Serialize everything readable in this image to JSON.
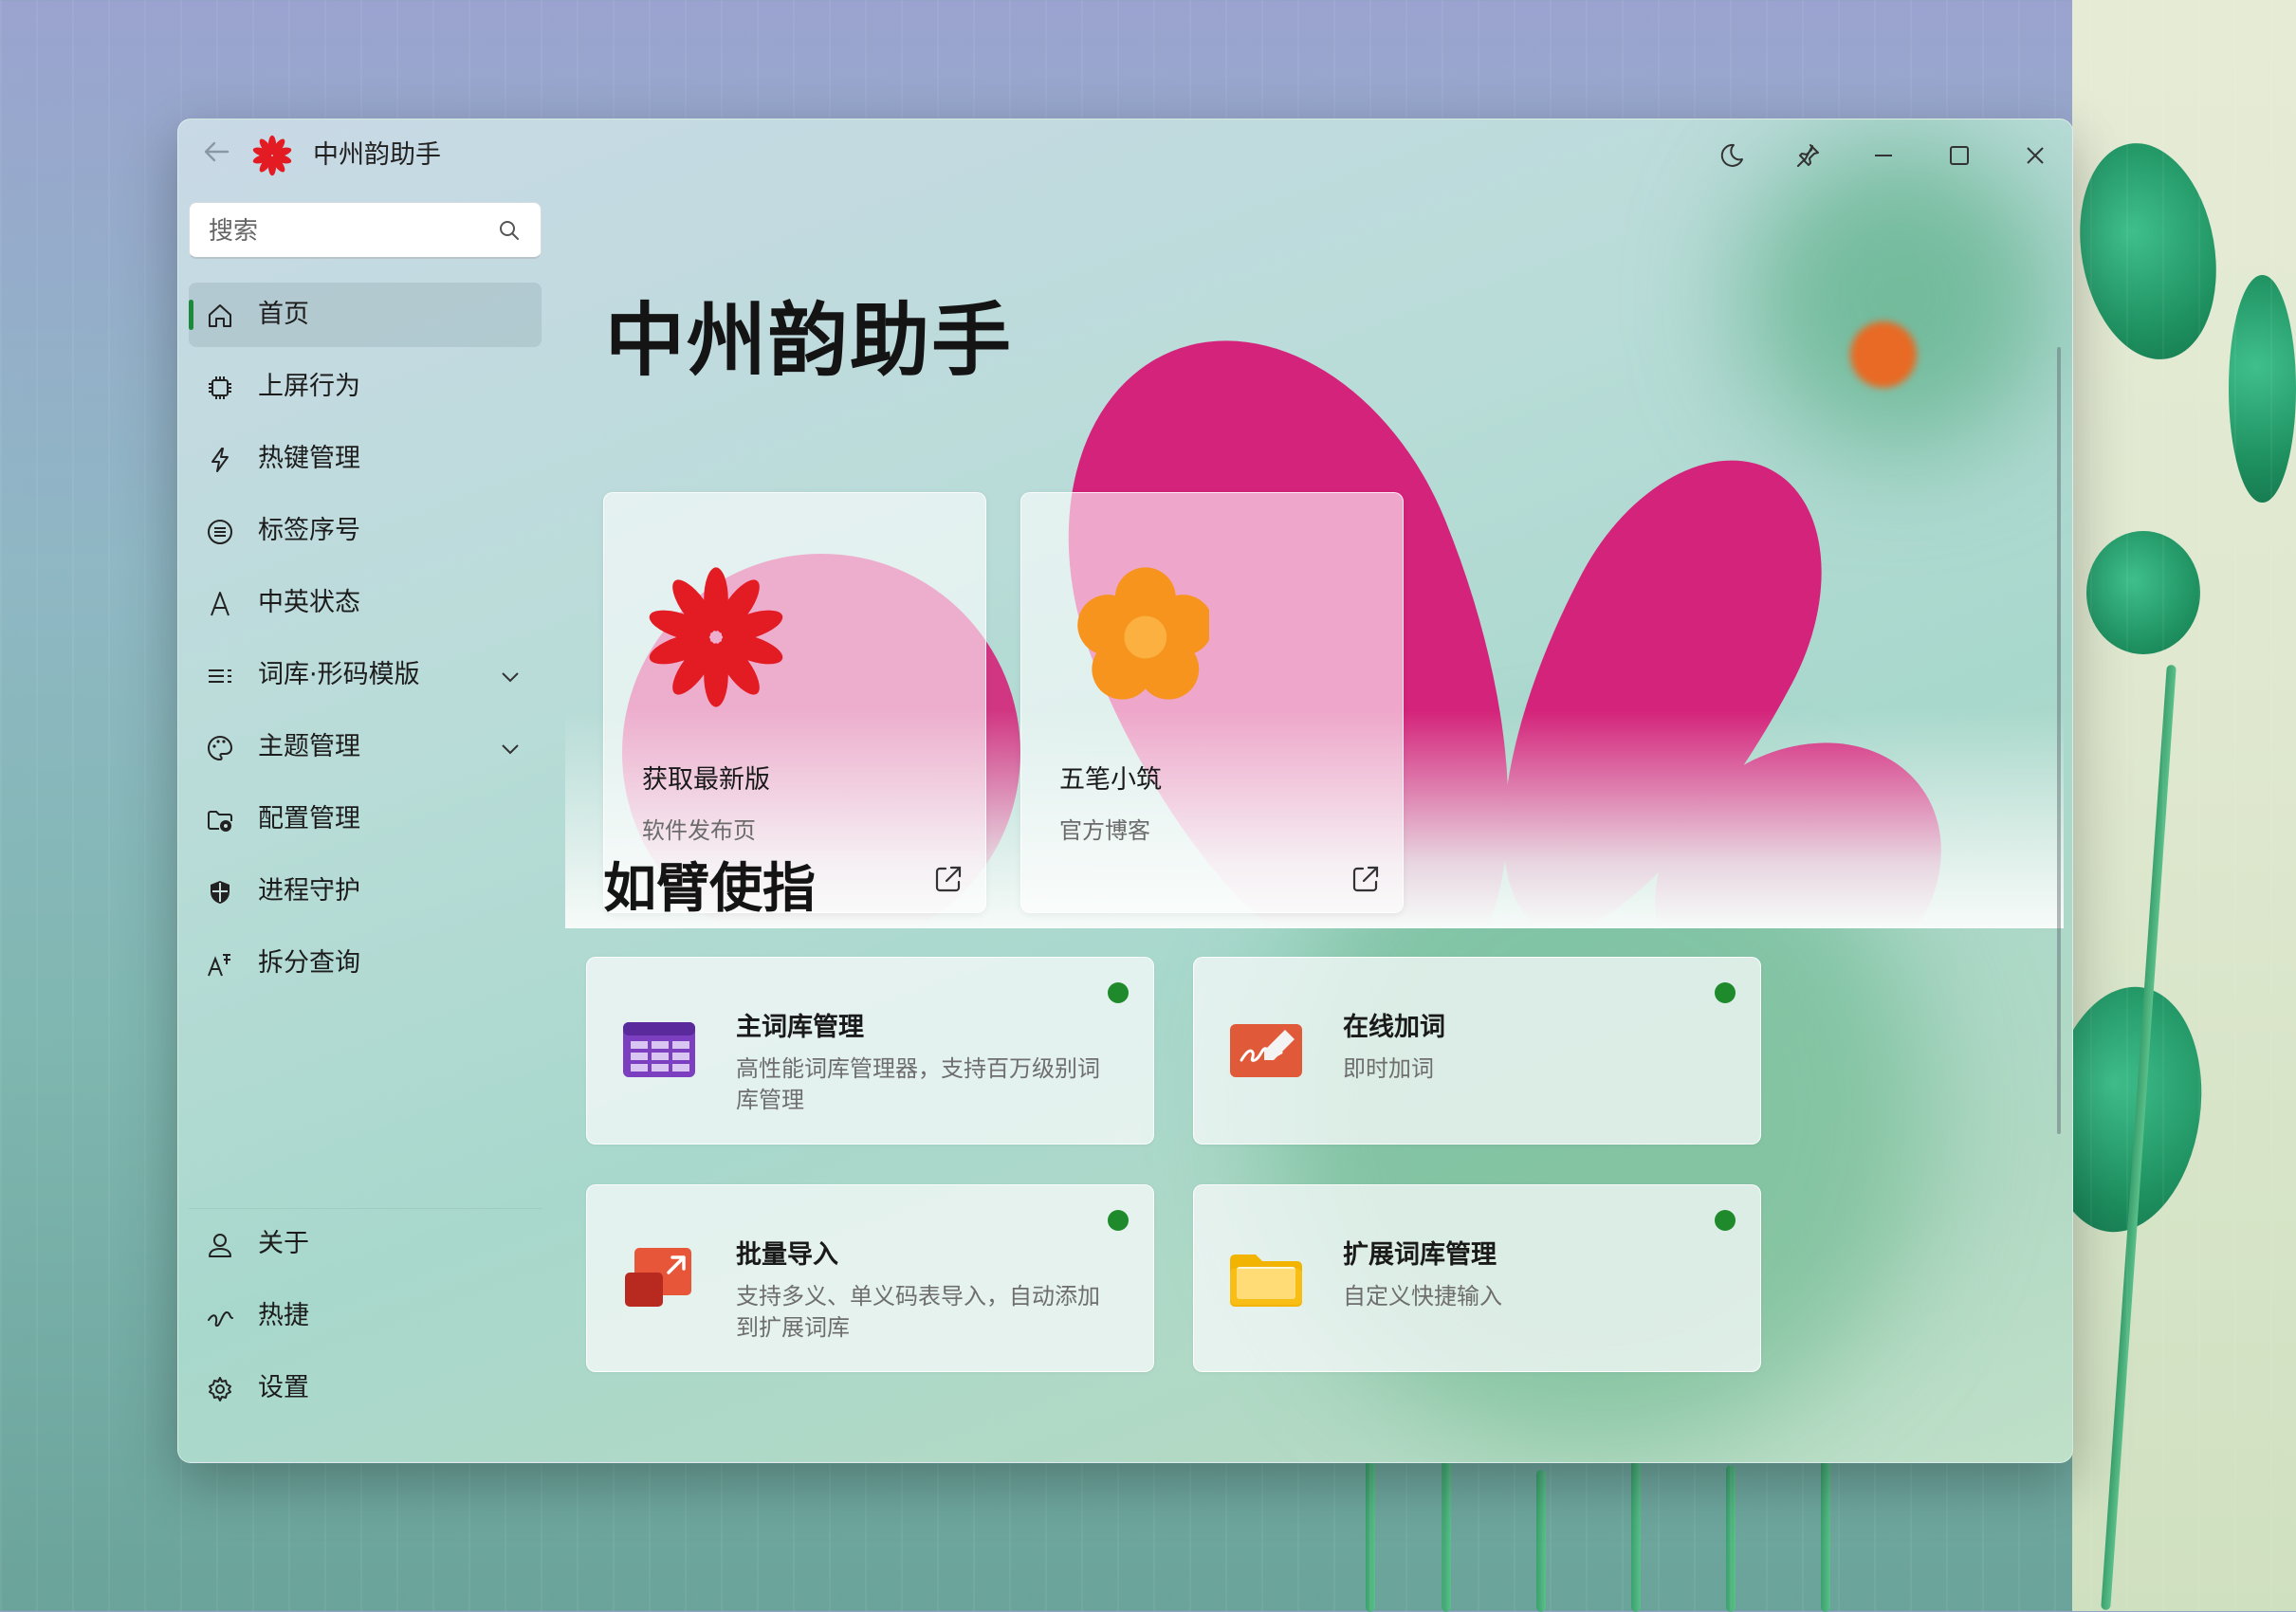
{
  "window": {
    "title": "中州韵助手",
    "accent": "#1b8a3a",
    "controls": [
      "moon-icon",
      "pin-icon",
      "minimize-icon",
      "maximize-icon",
      "close-icon"
    ]
  },
  "search": {
    "placeholder": "搜索",
    "value": ""
  },
  "sidebar": {
    "items": [
      {
        "label": "首页",
        "icon": "home-icon",
        "active": true
      },
      {
        "label": "上屏行为",
        "icon": "chip-icon"
      },
      {
        "label": "热键管理",
        "icon": "lightning-icon"
      },
      {
        "label": "标签序号",
        "icon": "list-circle-icon"
      },
      {
        "label": "中英状态",
        "icon": "letter-a-icon"
      },
      {
        "label": "词库·形码模版",
        "icon": "text-list-icon",
        "expandable": true
      },
      {
        "label": "主题管理",
        "icon": "palette-icon",
        "expandable": true
      },
      {
        "label": "配置管理",
        "icon": "folder-settings-icon"
      },
      {
        "label": "进程守护",
        "icon": "shield-icon"
      },
      {
        "label": "拆分查询",
        "icon": "text-effects-icon"
      }
    ],
    "footer": [
      {
        "label": "关于",
        "icon": "person-icon"
      },
      {
        "label": "热捷",
        "icon": "gesture-icon"
      },
      {
        "label": "设置",
        "icon": "gear-icon"
      }
    ]
  },
  "hero": {
    "title": "中州韵助手",
    "cards": [
      {
        "title": "获取最新版",
        "subtitle": "软件发布页",
        "logo": "red-flower-logo",
        "link_icon": "external-link-icon"
      },
      {
        "title": "五笔小筑",
        "subtitle": "官方博客",
        "logo": "orange-flower-logo",
        "link_icon": "external-link-icon"
      }
    ]
  },
  "section": {
    "title": "如臂使指",
    "cards": [
      {
        "title": "主词库管理",
        "desc": "高性能词库管理器，支持百万级别词库管理",
        "icon": "table-icon",
        "status": "#1f8a2c"
      },
      {
        "title": "在线加词",
        "desc": "即时加词",
        "icon": "signature-icon",
        "status": "#1f8a2c"
      },
      {
        "title": "批量导入",
        "desc": "支持多义、单义码表导入，自动添加到扩展词库",
        "icon": "import-icon",
        "status": "#1f8a2c"
      },
      {
        "title": "扩展词库管理",
        "desc": "自定义快捷输入",
        "icon": "folder-icon",
        "status": "#1f8a2c"
      }
    ]
  }
}
